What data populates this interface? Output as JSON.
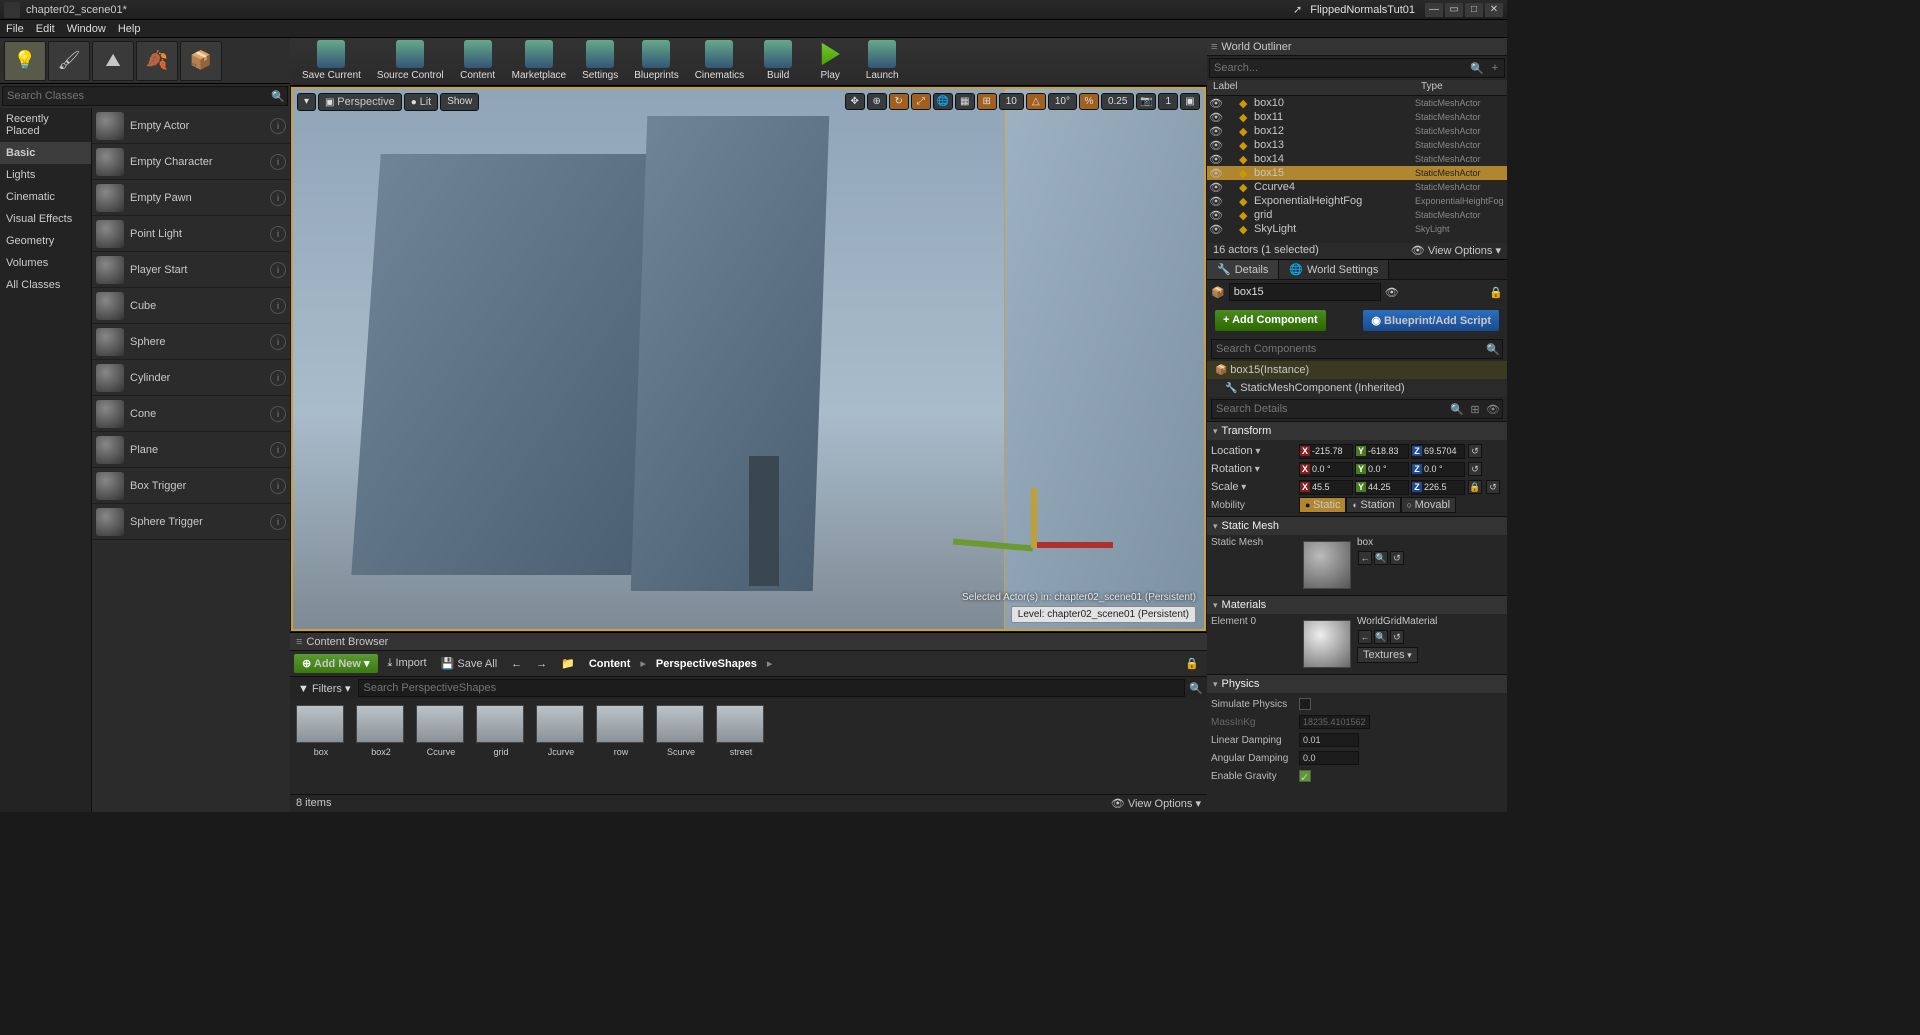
{
  "title": {
    "document": "chapter02_scene01*",
    "project": "FlippedNormalsTut01"
  },
  "menus": [
    "File",
    "Edit",
    "Window",
    "Help"
  ],
  "placeActors": {
    "searchPlaceholder": "Search Classes",
    "categories": [
      "Recently Placed",
      "Basic",
      "Lights",
      "Cinematic",
      "Visual Effects",
      "Geometry",
      "Volumes",
      "All Classes"
    ],
    "selectedCategory": "Basic",
    "items": [
      "Empty Actor",
      "Empty Character",
      "Empty Pawn",
      "Point Light",
      "Player Start",
      "Cube",
      "Sphere",
      "Cylinder",
      "Cone",
      "Plane",
      "Box Trigger",
      "Sphere Trigger"
    ]
  },
  "mainToolbar": [
    {
      "label": "Save Current"
    },
    {
      "label": "Source Control"
    },
    {
      "label": "Content"
    },
    {
      "label": "Marketplace"
    },
    {
      "label": "Settings"
    },
    {
      "label": "Blueprints"
    },
    {
      "label": "Cinematics"
    },
    {
      "label": "Build"
    },
    {
      "label": "Play",
      "play": true
    },
    {
      "label": "Launch"
    }
  ],
  "viewport": {
    "perspective": "Perspective",
    "lit": "Lit",
    "show": "Show",
    "grid": "10",
    "angle": "10°",
    "scale": "0.25",
    "cam": "1",
    "selectedInfo": "Selected Actor(s) in:  chapter02_scene01 (Persistent)",
    "levelInfo": "Level: chapter02_scene01 (Persistent)"
  },
  "contentBrowser": {
    "header": "Content Browser",
    "addNew": "Add New",
    "import": "Import",
    "saveAll": "Save All",
    "crumbs": [
      "Content",
      "PerspectiveShapes"
    ],
    "filters": "Filters",
    "searchPlaceholder": "Search PerspectiveShapes",
    "assets": [
      "box",
      "box2",
      "Ccurve",
      "grid",
      "Jcurve",
      "row",
      "Scurve",
      "street"
    ],
    "status": "8 items",
    "viewOptions": "View Options"
  },
  "outliner": {
    "header": "World Outliner",
    "searchPlaceholder": "Search...",
    "colLabel": "Label",
    "colType": "Type",
    "rows": [
      {
        "name": "box10",
        "type": "StaticMeshActor"
      },
      {
        "name": "box11",
        "type": "StaticMeshActor"
      },
      {
        "name": "box12",
        "type": "StaticMeshActor"
      },
      {
        "name": "box13",
        "type": "StaticMeshActor"
      },
      {
        "name": "box14",
        "type": "StaticMeshActor"
      },
      {
        "name": "box15",
        "type": "StaticMeshActor",
        "selected": true
      },
      {
        "name": "Ccurve4",
        "type": "StaticMeshActor"
      },
      {
        "name": "ExponentialHeightFog",
        "type": "ExponentialHeightFog"
      },
      {
        "name": "grid",
        "type": "StaticMeshActor"
      },
      {
        "name": "SkyLight",
        "type": "SkyLight"
      }
    ],
    "status": "16 actors (1 selected)",
    "viewOptions": "View Options"
  },
  "details": {
    "tabDetails": "Details",
    "tabWorld": "World Settings",
    "actorName": "box15",
    "addComponent": "+ Add Component",
    "blueprintEdit": "Blueprint/Add Script",
    "searchComponents": "Search Components",
    "compRoot": "box15(Instance)",
    "compChild": "StaticMeshComponent (Inherited)",
    "searchDetails": "Search Details",
    "transform": {
      "header": "Transform",
      "locationLabel": "Location",
      "rotationLabel": "Rotation",
      "scaleLabel": "Scale",
      "mobilityLabel": "Mobility",
      "loc": {
        "x": "-215.78",
        "y": "-618.83",
        "z": "69.5704"
      },
      "rot": {
        "x": "0.0 °",
        "y": "0.0 °",
        "z": "0.0 °"
      },
      "scl": {
        "x": "45.5",
        "y": "44.25",
        "z": "226.5"
      },
      "mobility": [
        "Static",
        "Station",
        "Movabl"
      ],
      "mobilitySel": "Static"
    },
    "staticMesh": {
      "header": "Static Mesh",
      "label": "Static Mesh",
      "value": "box"
    },
    "materials": {
      "header": "Materials",
      "element": "Element 0",
      "value": "WorldGridMaterial",
      "textures": "Textures"
    },
    "physics": {
      "header": "Physics",
      "simulate": "Simulate Physics",
      "massLabel": "MassInKg",
      "mass": "18235.4101562",
      "linDamp": "Linear Damping",
      "linDampV": "0.01",
      "angDamp": "Angular Damping",
      "angDampV": "0.0",
      "gravity": "Enable Gravity"
    }
  }
}
